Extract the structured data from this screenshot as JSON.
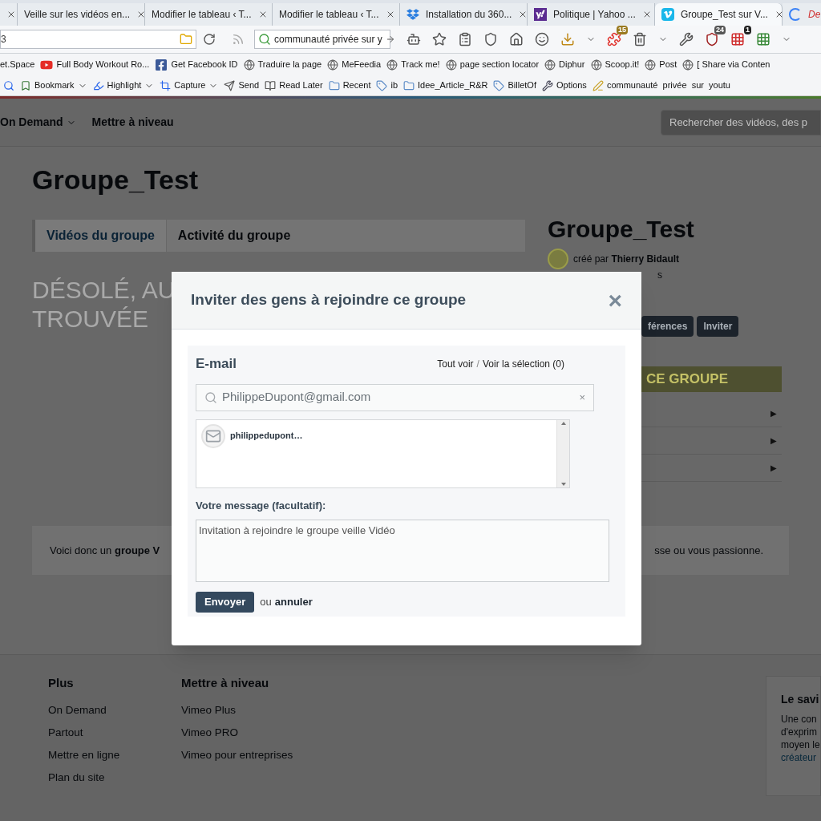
{
  "browser": {
    "tabs": [
      {
        "kind": "partial",
        "selected": false
      },
      {
        "title": "Veille sur les vidéos en...",
        "kind": "plain",
        "selected": false
      },
      {
        "title": "Modifier le tableau ‹ T...",
        "kind": "plain",
        "selected": false
      },
      {
        "title": "Modifier le tableau ‹ T...",
        "kind": "plain",
        "selected": false
      },
      {
        "title": "Installation du 360...",
        "kind": "dropbox",
        "selected": false
      },
      {
        "title": "Politique | Yahoo ...",
        "kind": "yahoo",
        "selected": false
      },
      {
        "title": "Groupe_Test sur V...",
        "kind": "vimeo",
        "selected": true
      },
      {
        "title": "De",
        "kind": "loading",
        "selected": false
      }
    ],
    "address": "3",
    "search": "communauté privée sur y",
    "toolbar_badges": [
      "15",
      "24",
      "1"
    ],
    "bookmarks": [
      {
        "label": "et.Space",
        "kind": "plain"
      },
      {
        "label": "Full Body Workout Ro...",
        "kind": "youtube"
      },
      {
        "label": "Get Facebook ID",
        "kind": "facebook"
      },
      {
        "label": "Traduire la page",
        "kind": "globe"
      },
      {
        "label": "MeFeedia",
        "kind": "globe"
      },
      {
        "label": "Track me!",
        "kind": "globe"
      },
      {
        "label": "page section locator",
        "kind": "globe"
      },
      {
        "label": "Diphur",
        "kind": "globe"
      },
      {
        "label": "Scoop.it!",
        "kind": "globe"
      },
      {
        "label": "Post",
        "kind": "globe"
      },
      {
        "label": "[ Share via Conten",
        "kind": "globe"
      }
    ],
    "addon_toolbar": [
      {
        "label": "Bookmark",
        "kind": "bookmark",
        "dropdown": true
      },
      {
        "label": "Highlight",
        "kind": "highlight",
        "dropdown": true
      },
      {
        "label": "Capture",
        "kind": "capture",
        "dropdown": true
      },
      {
        "label": "Send",
        "kind": "send",
        "dropdown": false
      },
      {
        "label": "Read Later",
        "kind": "read",
        "dropdown": false
      },
      {
        "label": "Recent",
        "kind": "folder",
        "dropdown": false
      },
      {
        "label": "ib",
        "kind": "tag",
        "dropdown": false
      },
      {
        "label": "Idee_Article_R&R",
        "kind": "folder",
        "dropdown": false
      },
      {
        "label": "BilletOf",
        "kind": "tag",
        "dropdown": false
      },
      {
        "label": "Options",
        "kind": "wrench",
        "dropdown": false
      },
      {
        "label": "communauté  privée  sur  youtu",
        "kind": "marker",
        "dropdown": false
      }
    ]
  },
  "site_nav": {
    "items": [
      {
        "label": "On Demand",
        "dropdown": true
      },
      {
        "label": "Mettre à niveau",
        "dropdown": false
      }
    ],
    "search_placeholder": "Rechercher des vidéos, des p"
  },
  "group": {
    "title": "Groupe_Test",
    "tabs": [
      {
        "label": "Vidéos du groupe",
        "selected": true
      },
      {
        "label": "Activité du groupe",
        "selected": false
      }
    ],
    "empty_message": [
      "DÉSOLÉ, AU",
      "TROUVÉE"
    ],
    "sidebar": {
      "title": "Groupe_Test",
      "created_prefix": "créé par",
      "creator": "Thierry Bidault",
      "fragment": "s",
      "buttons": [
        "férences",
        "Inviter"
      ],
      "banner": "CE GROUPE",
      "rows": [
        {
          "arrow": "▶"
        },
        {
          "arrow": "▶"
        },
        {
          "arrow": "▶"
        }
      ]
    },
    "description": {
      "start": "Voici donc un **groupe V**",
      "end": "sse ou vous passionne."
    }
  },
  "modal": {
    "title": "Inviter des gens à rejoindre ce groupe",
    "close": "×",
    "email_label": "E-mail",
    "links": [
      "Tout voir",
      "Voir la sélection (0)"
    ],
    "separator": "/",
    "search": {
      "value": "PhilippeDupont@gmail.com",
      "clear": "×"
    },
    "results": [
      {
        "name": "philippedupont…"
      }
    ],
    "message_label": "Votre message (facultatif):",
    "message": "Invitation à rejoindre le groupe veille Vidéo",
    "submit": "Envoyer",
    "or": "ou",
    "cancel": "annuler"
  },
  "footer": {
    "columns": [
      {
        "title": "Plus",
        "links": [
          "On Demand",
          "Partout",
          "Mettre en ligne",
          "Plan du site"
        ]
      },
      {
        "title": "Mettre à niveau",
        "links": [
          "Vimeo Plus",
          "Vimeo PRO",
          "Vimeo pour entreprises"
        ]
      }
    ],
    "card": {
      "title": "Le savi",
      "lines": [
        "Une con",
        "d'exprim",
        "moyen le"
      ],
      "link": "créateur"
    }
  }
}
